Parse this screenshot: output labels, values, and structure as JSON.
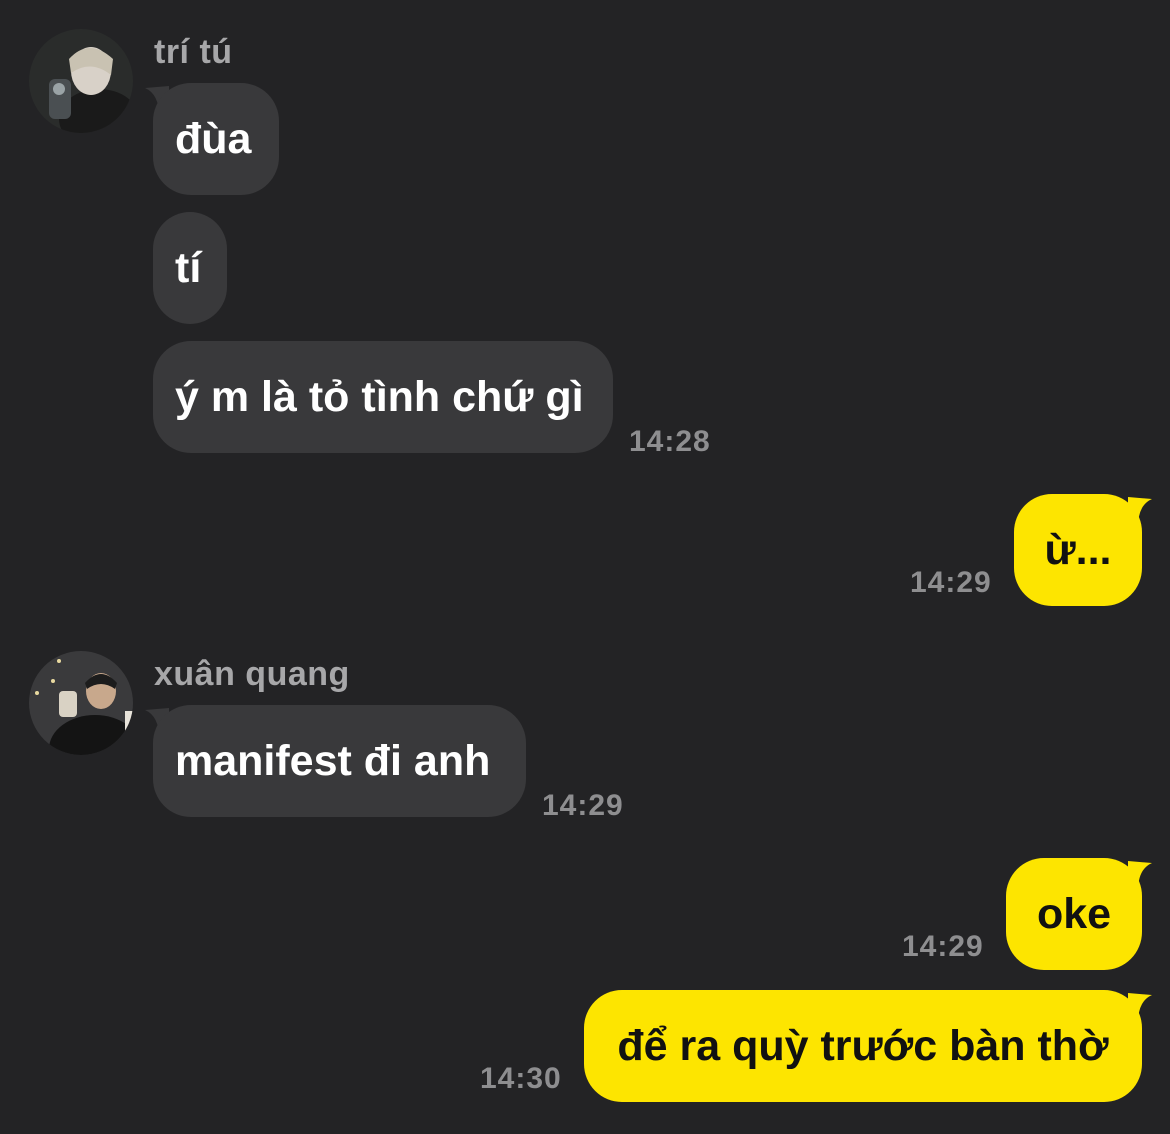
{
  "colors": {
    "background": "#232325",
    "incoming_bubble": "#39393b",
    "outgoing_bubble": "#fde500",
    "timestamp": "#8e8e90",
    "sender_name": "#a7a7a9"
  },
  "conversation": [
    {
      "sender": "trí tú",
      "avatar": "profile-photo-avatar",
      "messages": [
        "đùa",
        "tí",
        "ý m là tỏ tình chứ gì"
      ],
      "time": "14:28"
    },
    {
      "outgoing": true,
      "messages": [
        "ừ..."
      ],
      "time": "14:29"
    },
    {
      "sender": "xuân quang",
      "avatar": "profile-photo-avatar",
      "messages": [
        "manifest đi anh"
      ],
      "time": "14:29"
    },
    {
      "outgoing": true,
      "messages": [
        "oke"
      ],
      "time": "14:29"
    },
    {
      "outgoing": true,
      "messages": [
        "để ra quỳ trước bàn thờ"
      ],
      "time": "14:30"
    }
  ]
}
